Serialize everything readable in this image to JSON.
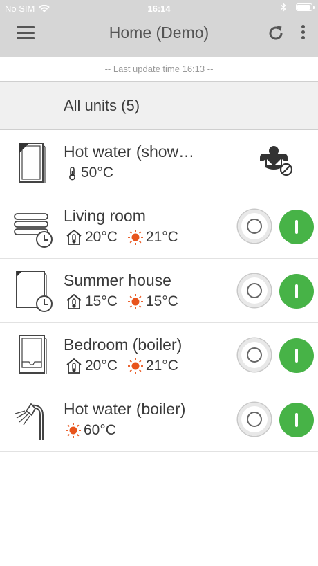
{
  "status_bar": {
    "carrier": "No SIM",
    "time": "16:14"
  },
  "header": {
    "title": "Home (Demo)"
  },
  "last_update": "-- Last update time 16:13 --",
  "all_units_label": "All units (5)",
  "units": [
    {
      "name": "Hot water (show…",
      "temps": [
        {
          "kind": "thermometer",
          "value": "50°C"
        }
      ]
    },
    {
      "name": "Living room",
      "temps": [
        {
          "kind": "indoor",
          "value": "20°C"
        },
        {
          "kind": "setpoint",
          "value": "21°C"
        }
      ]
    },
    {
      "name": "Summer house",
      "temps": [
        {
          "kind": "indoor",
          "value": "15°C"
        },
        {
          "kind": "setpoint",
          "value": "15°C"
        }
      ]
    },
    {
      "name": "Bedroom (boiler)",
      "temps": [
        {
          "kind": "indoor",
          "value": "20°C"
        },
        {
          "kind": "setpoint",
          "value": "21°C"
        }
      ]
    },
    {
      "name": "Hot water (boiler)",
      "temps": [
        {
          "kind": "setpoint",
          "value": "60°C"
        }
      ]
    }
  ],
  "colors": {
    "on_green": "#47b347",
    "sun_orange": "#e8541c",
    "header_grey": "#d6d6d6"
  }
}
